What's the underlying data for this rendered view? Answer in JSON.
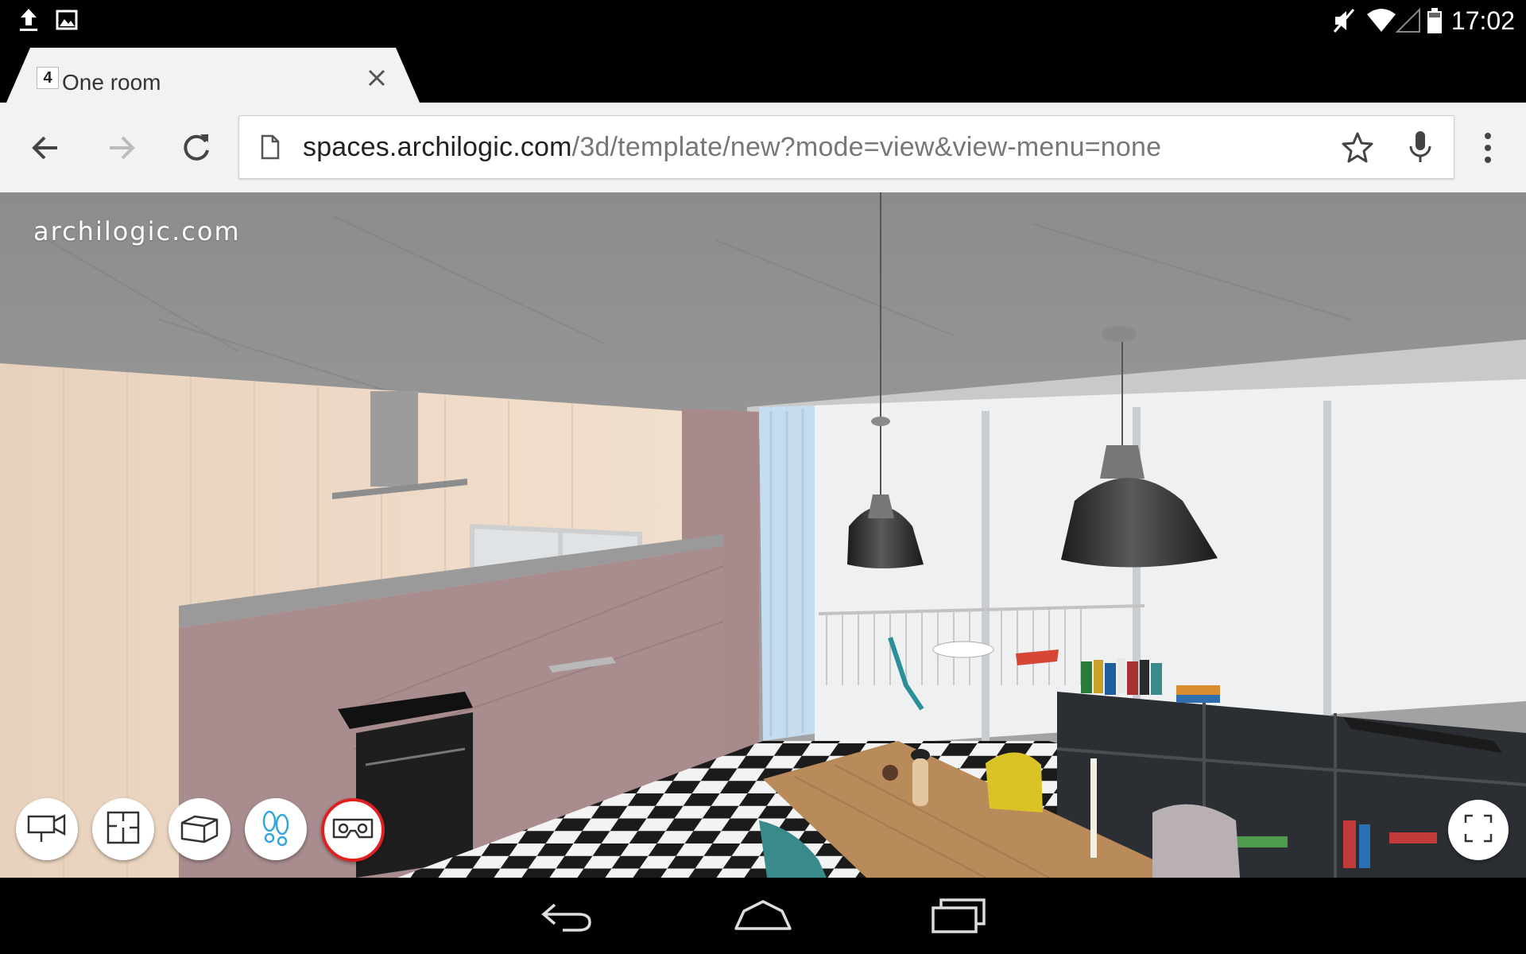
{
  "status_bar": {
    "left_icons": [
      "upload-icon",
      "image-icon"
    ],
    "right_icons": [
      "mute-icon",
      "wifi-icon",
      "signal-icon",
      "battery-icon"
    ],
    "time": "17:02"
  },
  "browser": {
    "tab": {
      "title": "One room",
      "favicon": "4",
      "close_icon": "close-icon"
    },
    "toolbar": {
      "back_icon": "back-arrow-icon",
      "forward_icon": "forward-arrow-icon",
      "reload_icon": "reload-icon",
      "url_host": "spaces.archilogic.com",
      "url_path": "/3d/template/new?mode=view&view-menu=none",
      "star_icon": "star-icon",
      "mic_icon": "mic-icon",
      "menu_icon": "overflow-menu-icon"
    }
  },
  "viewer": {
    "brand": "archilogic.com",
    "modes": [
      {
        "name": "camera-mode",
        "icon": "camera-icon",
        "active": false
      },
      {
        "name": "floorplan-mode",
        "icon": "floorplan-icon",
        "active": false
      },
      {
        "name": "3d-box-mode",
        "icon": "box-icon",
        "active": false
      },
      {
        "name": "walk-mode",
        "icon": "footsteps-icon",
        "active": false
      },
      {
        "name": "vr-mode",
        "icon": "vr-headset-icon",
        "active": true
      }
    ],
    "fullscreen_icon": "fullscreen-icon",
    "colors": {
      "active_ring": "#e02020",
      "walk_icon": "#35a6d8"
    }
  },
  "nav_bar": {
    "buttons": [
      "back-icon",
      "home-icon",
      "recents-icon"
    ]
  }
}
